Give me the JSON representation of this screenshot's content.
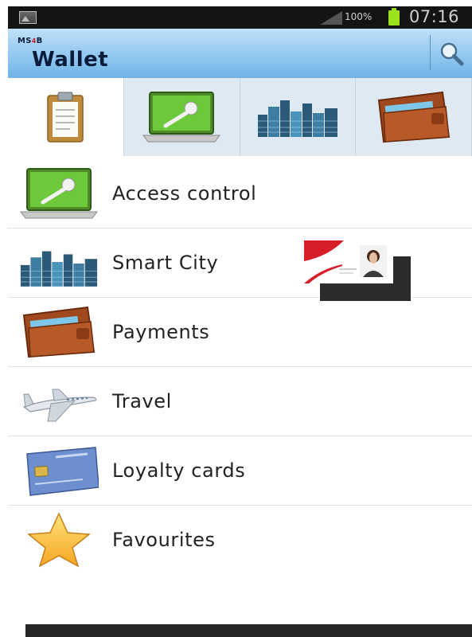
{
  "status_bar": {
    "battery_text": "100%",
    "time": "07:16",
    "battery_color": "#9be21a"
  },
  "header": {
    "brand_prefix": "MS",
    "brand_number": "4",
    "brand_suffix": "B",
    "title": "Wallet",
    "search_icon": "magnifier-icon"
  },
  "tabs": [
    {
      "icon": "clipboard-icon",
      "active": true
    },
    {
      "icon": "laptop-key-icon",
      "active": false
    },
    {
      "icon": "city-skyline-icon",
      "active": false
    },
    {
      "icon": "wallet-icon",
      "active": false
    }
  ],
  "menu": {
    "items": [
      {
        "label": "Access control",
        "icon": "laptop-key-icon"
      },
      {
        "label": "Smart City",
        "icon": "city-skyline-icon"
      },
      {
        "label": "Payments",
        "icon": "wallet-icon"
      },
      {
        "label": "Travel",
        "icon": "airplane-icon"
      },
      {
        "label": "Loyalty cards",
        "icon": "loyalty-card-icon"
      },
      {
        "label": "Favourites",
        "icon": "star-icon"
      }
    ]
  },
  "overlay_card": {
    "icon": "id-card-thumbnail"
  },
  "colors": {
    "appbar_top": "#bfe0f8",
    "appbar_bottom": "#6fb2e6",
    "tab_bg": "#dfe9f1"
  }
}
